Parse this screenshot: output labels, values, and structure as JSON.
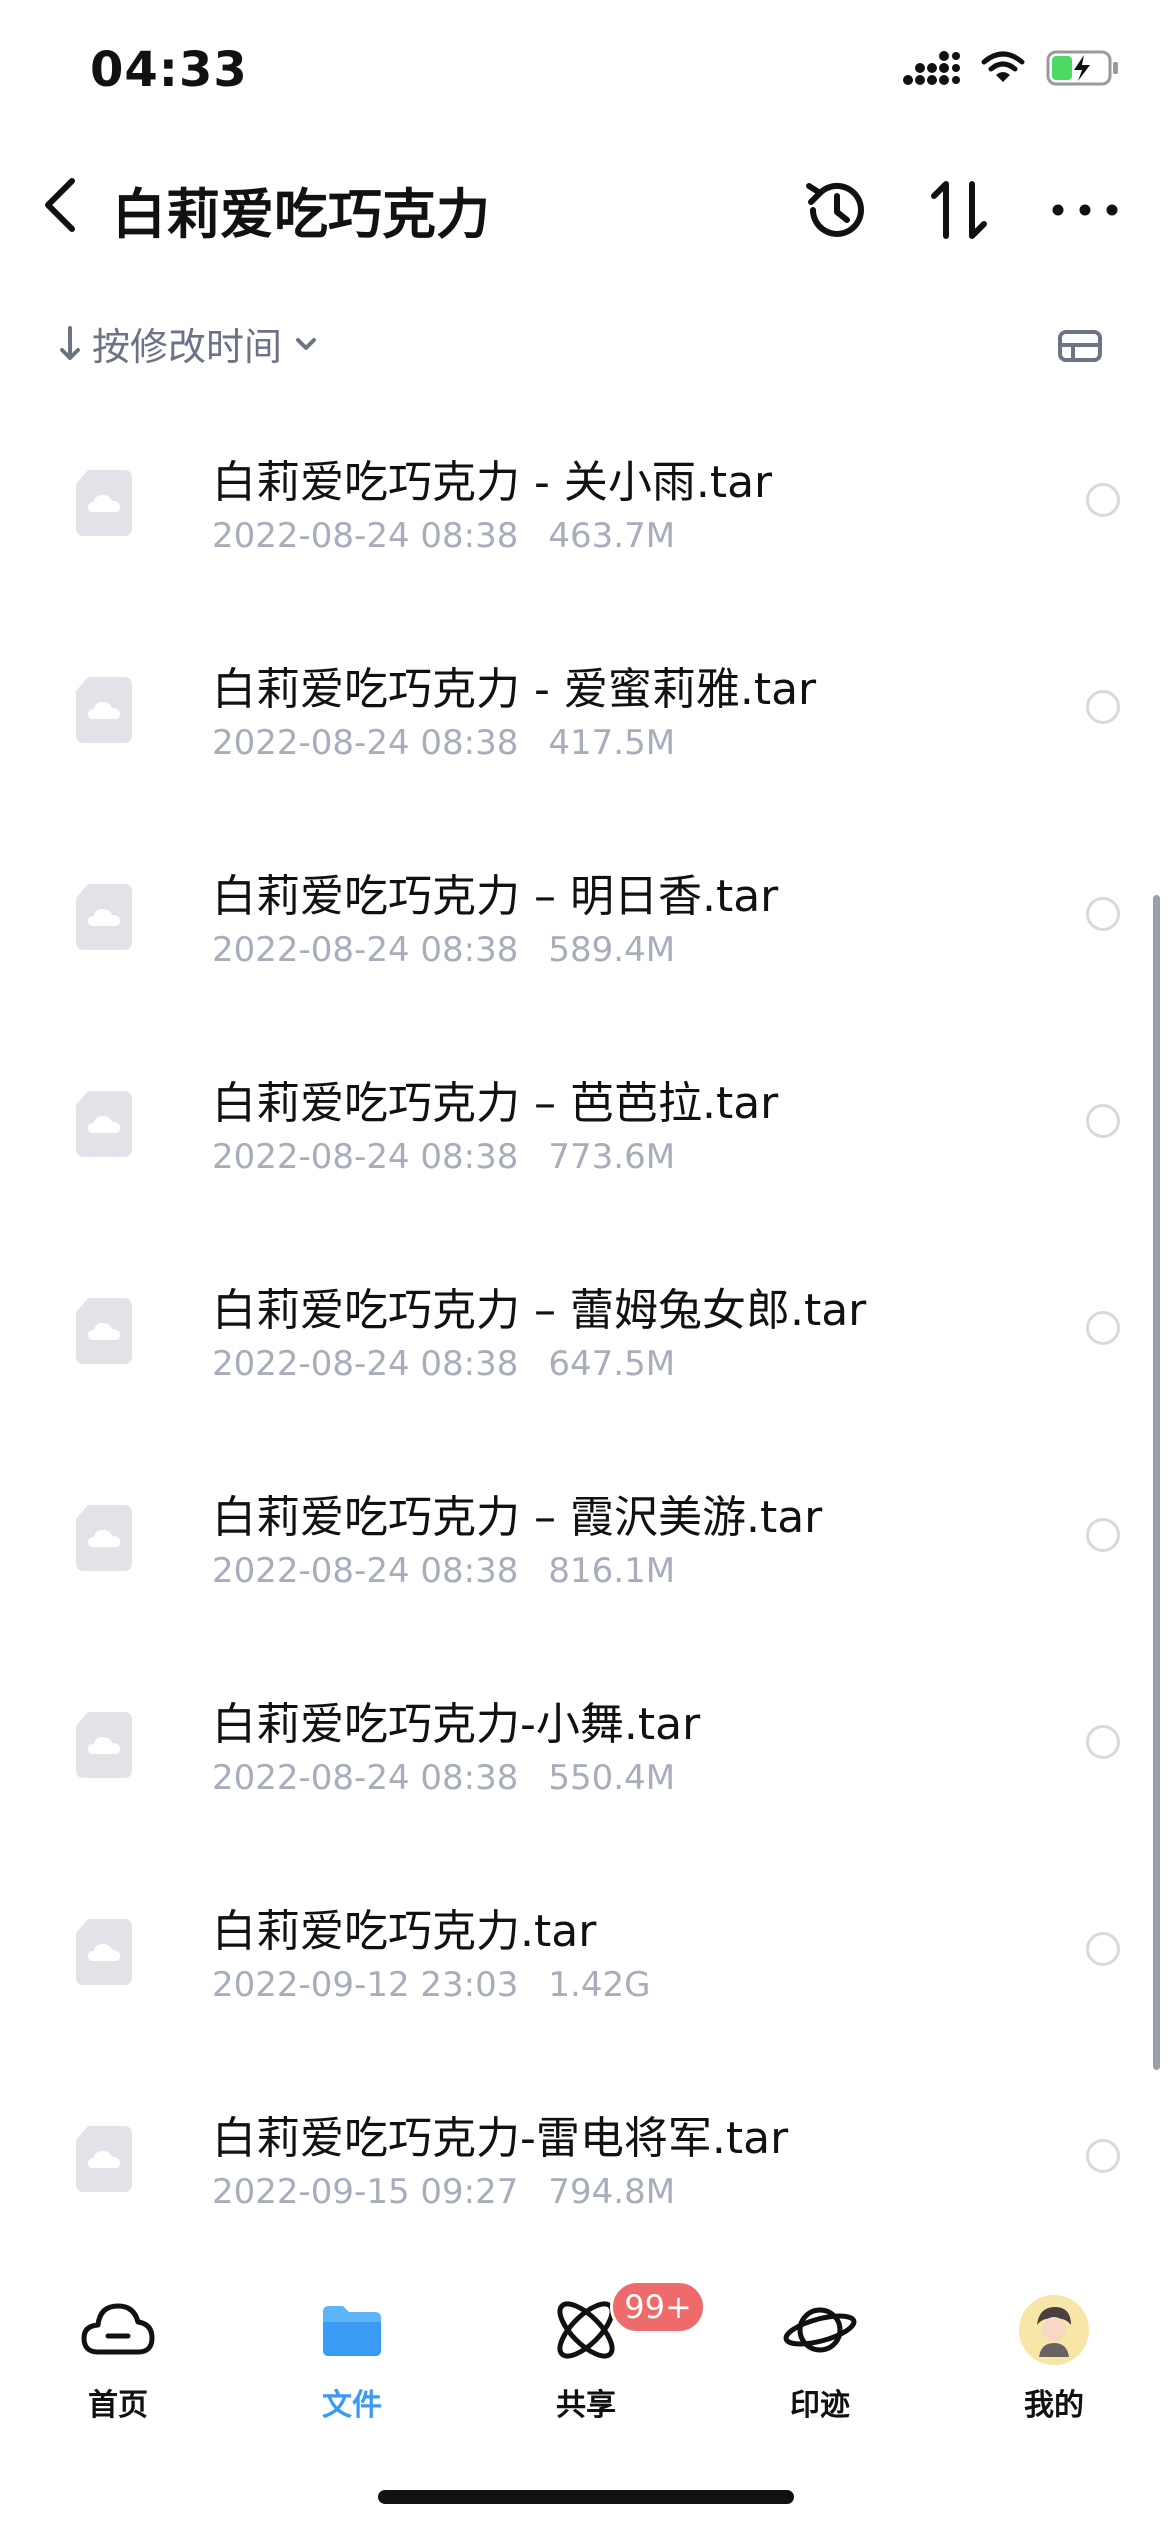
{
  "status_bar": {
    "time": "04:33"
  },
  "header": {
    "title": "白莉爱吃巧克力"
  },
  "sort": {
    "label": "按修改时间"
  },
  "files": [
    {
      "name": "白莉爱吃巧克力 - 关小雨.tar",
      "date": "2022-08-24 08:38",
      "size": "463.7M"
    },
    {
      "name": "白莉爱吃巧克力 - 爱蜜莉雅.tar",
      "date": "2022-08-24 08:38",
      "size": "417.5M"
    },
    {
      "name": "白莉爱吃巧克力 – 明日香.tar",
      "date": "2022-08-24 08:38",
      "size": "589.4M"
    },
    {
      "name": "白莉爱吃巧克力 – 芭芭拉.tar",
      "date": "2022-08-24 08:38",
      "size": "773.6M"
    },
    {
      "name": "白莉爱吃巧克力 – 蕾姆兔女郎.tar",
      "date": "2022-08-24 08:38",
      "size": "647.5M"
    },
    {
      "name": "白莉爱吃巧克力 – 霞沢美游.tar",
      "date": "2022-08-24 08:38",
      "size": "816.1M"
    },
    {
      "name": "白莉爱吃巧克力-小舞.tar",
      "date": "2022-08-24 08:38",
      "size": "550.4M"
    },
    {
      "name": "白莉爱吃巧克力.tar",
      "date": "2022-09-12 23:03",
      "size": "1.42G"
    },
    {
      "name": "白莉爱吃巧克力-雷电将军.tar",
      "date": "2022-09-15 09:27",
      "size": "794.8M"
    }
  ],
  "tabs": [
    {
      "label": "首页",
      "icon": "cloud-icon"
    },
    {
      "label": "文件",
      "icon": "folder-icon",
      "active": true
    },
    {
      "label": "共享",
      "icon": "share-orbit-icon",
      "badge": "99+"
    },
    {
      "label": "印迹",
      "icon": "planet-icon"
    },
    {
      "label": "我的",
      "icon": "avatar"
    }
  ],
  "colors": {
    "accent": "#3a9bf5",
    "badge": "#ef6a6a",
    "meta_text": "#a7adbb",
    "battery_green": "#4cd964"
  }
}
